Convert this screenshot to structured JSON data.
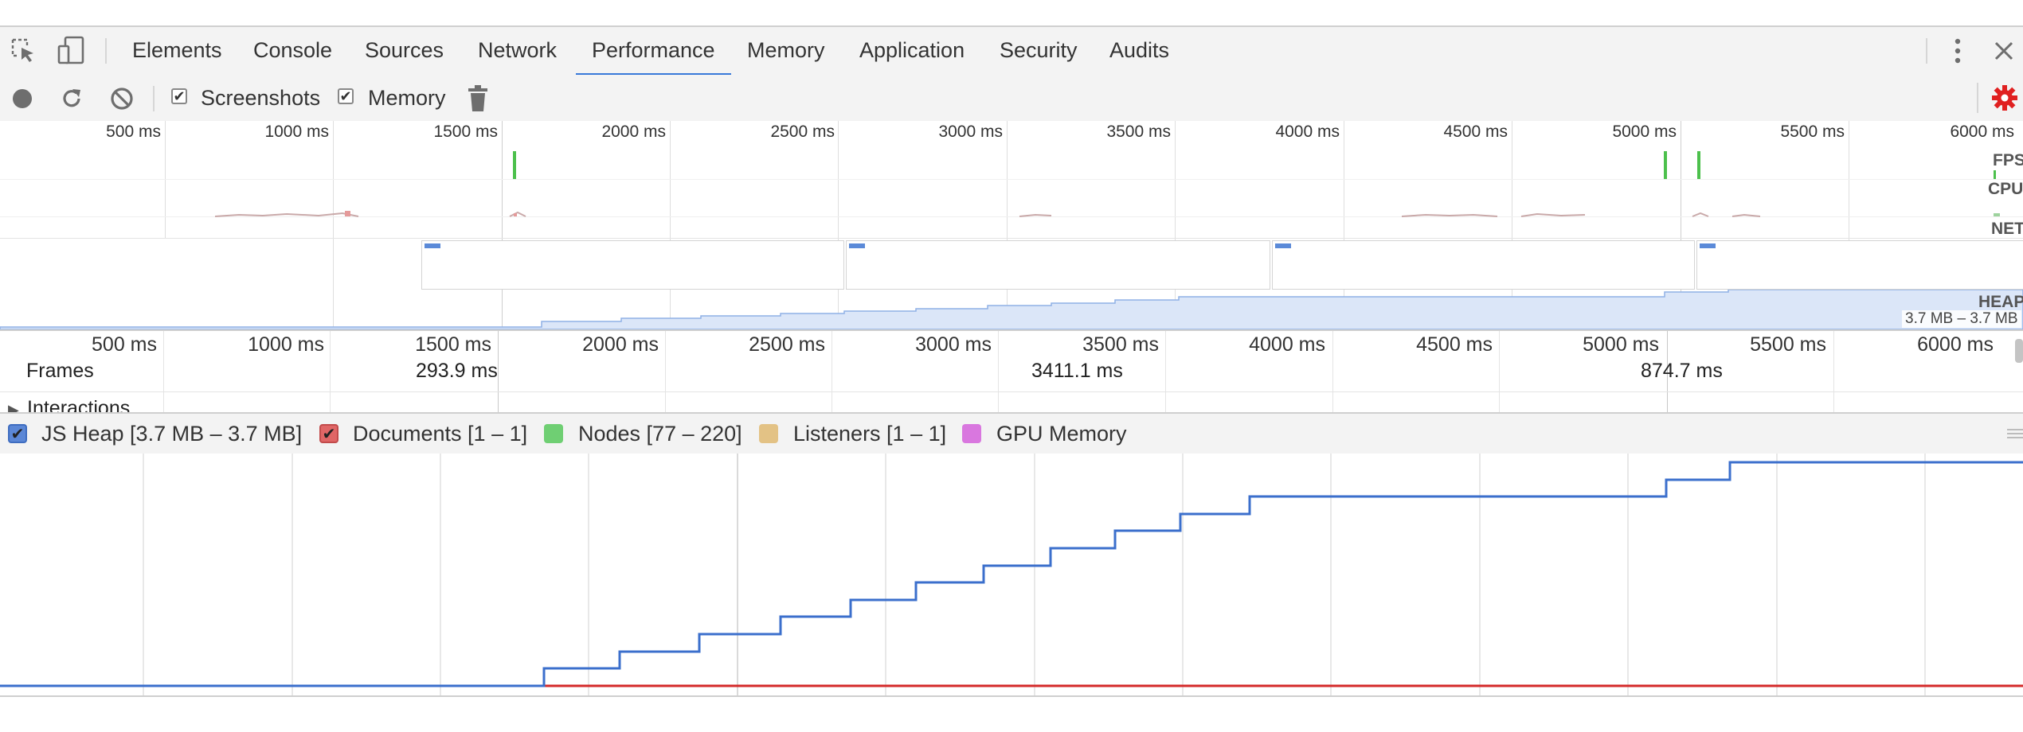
{
  "tabs": [
    "Elements",
    "Console",
    "Sources",
    "Network",
    "Performance",
    "Memory",
    "Application",
    "Security",
    "Audits"
  ],
  "active_tab": "Performance",
  "toolbar": {
    "screenshots_label": "Screenshots",
    "screenshots_checked": true,
    "memory_label": "Memory",
    "memory_checked": true
  },
  "overview": {
    "ticks": [
      "500 ms",
      "1000 ms",
      "1500 ms",
      "2000 ms",
      "2500 ms",
      "3000 ms",
      "3500 ms",
      "4000 ms",
      "4500 ms",
      "5000 ms",
      "5500 ms",
      "6000 ms"
    ],
    "tracks": {
      "fps": "FPS",
      "cpu": "CPU",
      "net": "NET",
      "heap": "HEAP"
    },
    "heap_range": "3.7 MB – 3.7 MB"
  },
  "ruler": {
    "ticks": [
      "500 ms",
      "1000 ms",
      "1500 ms",
      "2000 ms",
      "2500 ms",
      "3000 ms",
      "3500 ms",
      "4000 ms",
      "4500 ms",
      "5000 ms",
      "5500 ms",
      "6000 ms"
    ],
    "frames_label": "Frames",
    "frame_durations": [
      "293.9 ms",
      "3411.1 ms",
      "874.7 ms"
    ],
    "interactions_label": "Interactions"
  },
  "legend": [
    {
      "label": "JS Heap [3.7 MB – 3.7 MB]",
      "color": "#5b87d6",
      "checked": true
    },
    {
      "label": "Documents [1 – 1]",
      "color": "#e06666",
      "checked": true
    },
    {
      "label": "Nodes [77 – 220]",
      "color": "#6fcf73",
      "checked": false
    },
    {
      "label": "Listeners [1 – 1]",
      "color": "#e3c285",
      "checked": false
    },
    {
      "label": "GPU Memory",
      "color": "#d977df",
      "checked": false
    }
  ],
  "colors": {
    "accent": "#3879d9",
    "record_settings": "#e02020",
    "js_heap": "#3b6fcc",
    "documents": "#d42a2a",
    "fps": "#4cc04c"
  }
}
